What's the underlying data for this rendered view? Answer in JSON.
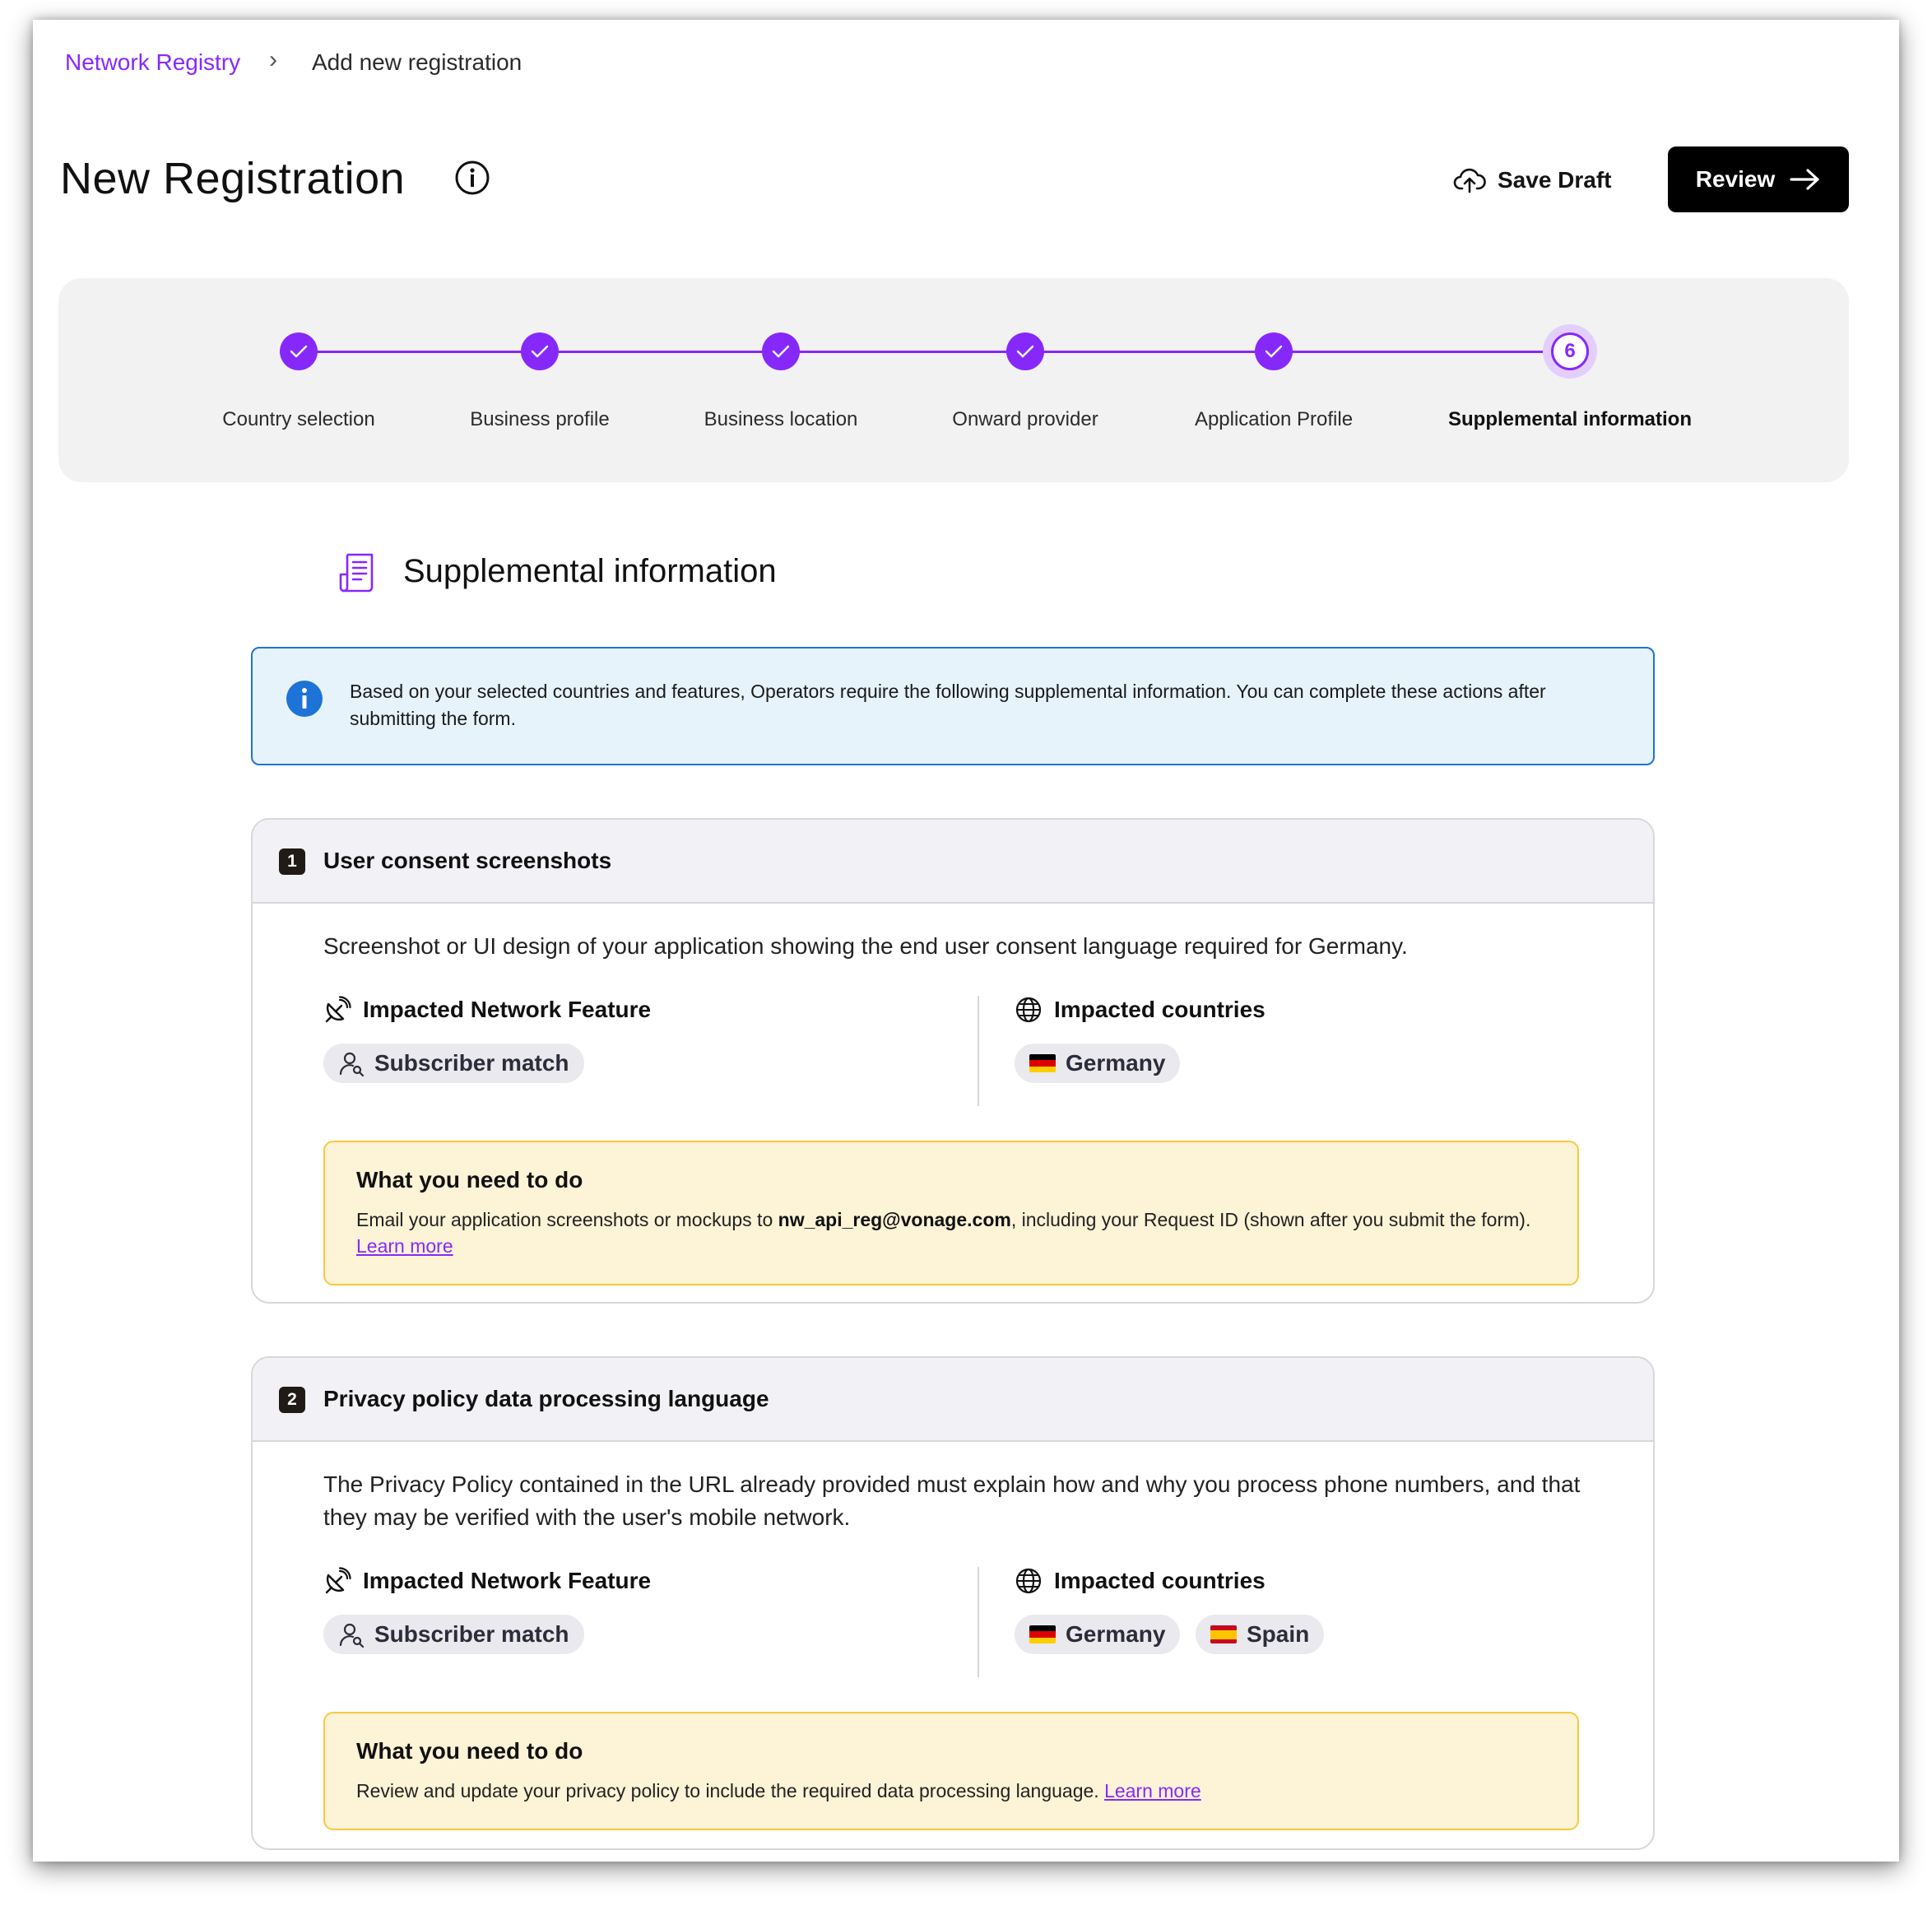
{
  "breadcrumb": {
    "root": "Network Registry",
    "separator": "›",
    "current": "Add new registration"
  },
  "header": {
    "title": "New Registration",
    "save_draft": "Save Draft",
    "review": "Review"
  },
  "stepper": {
    "steps": [
      {
        "label": "Country selection",
        "status": "complete"
      },
      {
        "label": "Business profile",
        "status": "complete"
      },
      {
        "label": "Business location",
        "status": "complete"
      },
      {
        "label": "Onward provider",
        "status": "complete"
      },
      {
        "label": "Application Profile",
        "status": "complete"
      },
      {
        "label": "Supplemental information",
        "status": "current",
        "number": "6"
      }
    ]
  },
  "section": {
    "title": "Supplemental information",
    "icon": "document-icon"
  },
  "banner": {
    "text": "Based on your selected countries and features, Operators require the following supplemental information. You can complete these actions after submitting the form."
  },
  "cards": [
    {
      "number": "1",
      "title": "User consent screenshots",
      "description": "Screenshot or UI design of your application showing the end user consent language required for Germany.",
      "feature_label": "Impacted Network Feature",
      "feature": "Subscriber match",
      "countries_label": "Impacted countries",
      "countries": [
        "Germany"
      ],
      "todo_title": "What you need to do",
      "todo_text_before": "Email your application screenshots or mockups to ",
      "todo_email": "nw_api_reg@vonage.com",
      "todo_text_after": ", including your Request ID (shown after you submit the form). ",
      "todo_link": "Learn more"
    },
    {
      "number": "2",
      "title": "Privacy policy data processing language",
      "description": "The Privacy Policy contained in the URL already provided must explain how and why you process phone numbers, and that they may be verified with the user's mobile network.",
      "feature_label": "Impacted Network Feature",
      "feature": "Subscriber match",
      "countries_label": "Impacted countries",
      "countries": [
        "Germany",
        "Spain"
      ],
      "todo_title": "What you need to do",
      "todo_text": "Review and update your privacy policy to include the required data processing language. ",
      "todo_link": "Learn more"
    }
  ],
  "colors": {
    "accent": "#8728fb",
    "info": "#1e73d6",
    "warning_border": "#f6c940"
  }
}
